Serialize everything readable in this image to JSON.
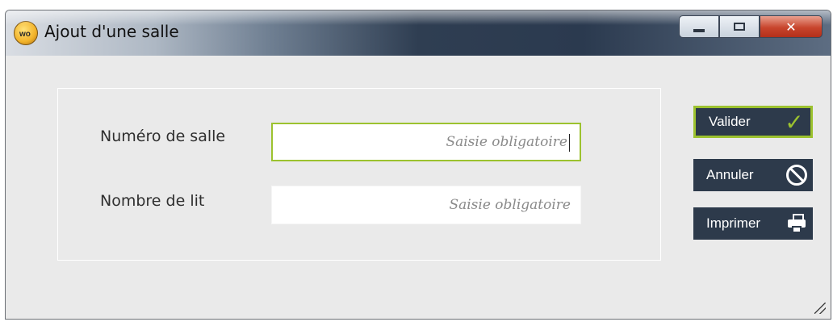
{
  "window": {
    "title": "Ajout d'une salle",
    "accent_color": "#9cc22f",
    "button_color": "#2d3a4b"
  },
  "form": {
    "room_number": {
      "label": "Numéro de salle",
      "placeholder": "Saisie obligatoire",
      "value": ""
    },
    "bed_count": {
      "label": "Nombre de lit",
      "placeholder": "Saisie obligatoire",
      "value": ""
    }
  },
  "actions": {
    "validate_label": "Valider",
    "cancel_label": "Annuler",
    "print_label": "Imprimer"
  },
  "icons": {
    "validate": "checkmark-icon",
    "cancel": "ban-icon",
    "print": "printer-icon"
  }
}
